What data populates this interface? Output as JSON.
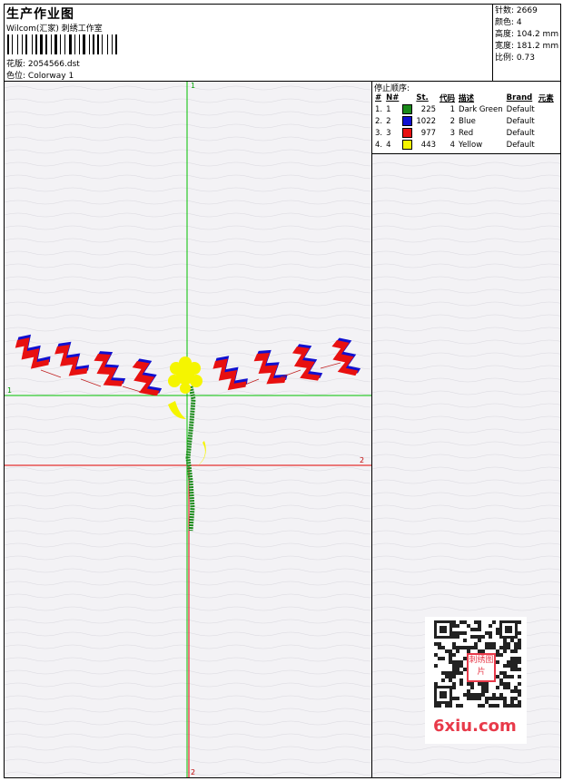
{
  "header": {
    "title": "生产作业图",
    "subtitle": "Wilcom(汇家) 刺绣工作室",
    "design_label": "花版:",
    "design_value": "2054566.dst",
    "colorway_label": "色位:",
    "colorway_value": "Colorway 1"
  },
  "stats": [
    {
      "label": "针数:",
      "value": "2669"
    },
    {
      "label": "颜色:",
      "value": "4"
    },
    {
      "label": "高度:",
      "value": "104.2 mm"
    },
    {
      "label": "宽度:",
      "value": "181.2 mm"
    },
    {
      "label": "比例:",
      "value": "0.73"
    }
  ],
  "sequence": {
    "title": "停止顺序:",
    "columns": [
      "#",
      "N#",
      "St.",
      "代码",
      "描述",
      "Brand",
      "元素"
    ],
    "rows": [
      {
        "n": "1.",
        "nn": "1",
        "color": "#1a8a1a",
        "st": "225",
        "code": "1",
        "desc": "Dark Green",
        "brand": "Default"
      },
      {
        "n": "2.",
        "nn": "2",
        "color": "#1010d0",
        "st": "1022",
        "code": "2",
        "desc": "Blue",
        "brand": "Default"
      },
      {
        "n": "3.",
        "nn": "3",
        "color": "#e81010",
        "st": "977",
        "code": "3",
        "desc": "Red",
        "brand": "Default"
      },
      {
        "n": "4.",
        "nn": "4",
        "color": "#f5f500",
        "st": "443",
        "code": "4",
        "desc": "Yellow",
        "brand": "Default"
      }
    ]
  },
  "axes": {
    "v_top": "1",
    "v_bottom": "2",
    "h1_left": "1",
    "h2_right": "2"
  },
  "watermark": {
    "text": "6xiu.com",
    "stamp": "刺绣图片",
    "color": "#e83a4a"
  },
  "colors": {
    "axis_green": "#00c000",
    "axis_red": "#e00000",
    "paper": "#f3f2f5"
  }
}
